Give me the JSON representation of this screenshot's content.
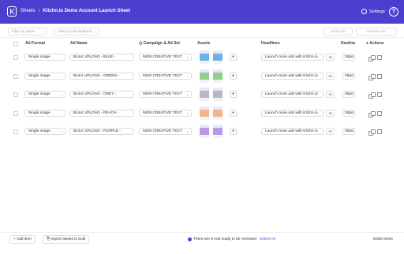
{
  "header": {
    "breadcrumb_parent": "Sheets",
    "breadcrumb_sep": "/",
    "title": "Kitchn.io Demo Account Launch Sheet",
    "settings_label": "Settings",
    "help_label": "?"
  },
  "filters": {
    "status_placeholder": "Filter by status",
    "feedback_placeholder": "Filter by last feedback",
    "bulk_edit_label": "Bulk Edit",
    "review_ads_label": "Review Ads"
  },
  "table": {
    "columns": [
      "Ad Format",
      "Ad Name",
      "Campaign & Ad Set",
      "Assets",
      "Headlines",
      "Destina",
      "Actions"
    ],
    "rows": [
      {
        "format": "Single image",
        "name": "BULK UPLOAD - BLUE -",
        "campaign": "NEW CREATIVE TEST",
        "headline": "Launch more ads with Kitchn.io",
        "headline_extra": "+1",
        "dest": "https:",
        "swatch": "#6fb0e6"
      },
      {
        "format": "Single image",
        "name": "BULK UPLOAD - GREEN -",
        "campaign": "NEW CREATIVE TEST",
        "headline": "Launch more ads with Kitchn.io",
        "headline_extra": "+1",
        "dest": "https:",
        "swatch": "#8cd08a"
      },
      {
        "format": "Single image",
        "name": "BULK UPLOAD - GREY -",
        "campaign": "NEW CREATIVE TEST",
        "headline": "Launch more ads with Kitchn.io",
        "headline_extra": "+1",
        "dest": "https:",
        "swatch": "#b7b9c2"
      },
      {
        "format": "Single image",
        "name": "BULK UPLOAD - PEACH -",
        "campaign": "NEW CREATIVE TEST",
        "headline": "Launch more ads with Kitchn.io",
        "headline_extra": "+1",
        "dest": "https:",
        "swatch": "#f2b48c"
      },
      {
        "format": "Single image",
        "name": "BULK UPLOAD - PURPLE -",
        "campaign": "NEW CREATIVE TEST",
        "headline": "Launch more ads with Kitchn.io",
        "headline_extra": "+1",
        "dest": "https:",
        "swatch": "#b79be6"
      }
    ]
  },
  "footer": {
    "add_item_label": "Add item",
    "import_label": "Import assets in bulk",
    "ready_text": "There are 5 Ads ready to be reviewed",
    "select_all_label": "Select All",
    "count_text": "5/300 items"
  },
  "colors": {
    "brand": "#4b3fcf"
  }
}
